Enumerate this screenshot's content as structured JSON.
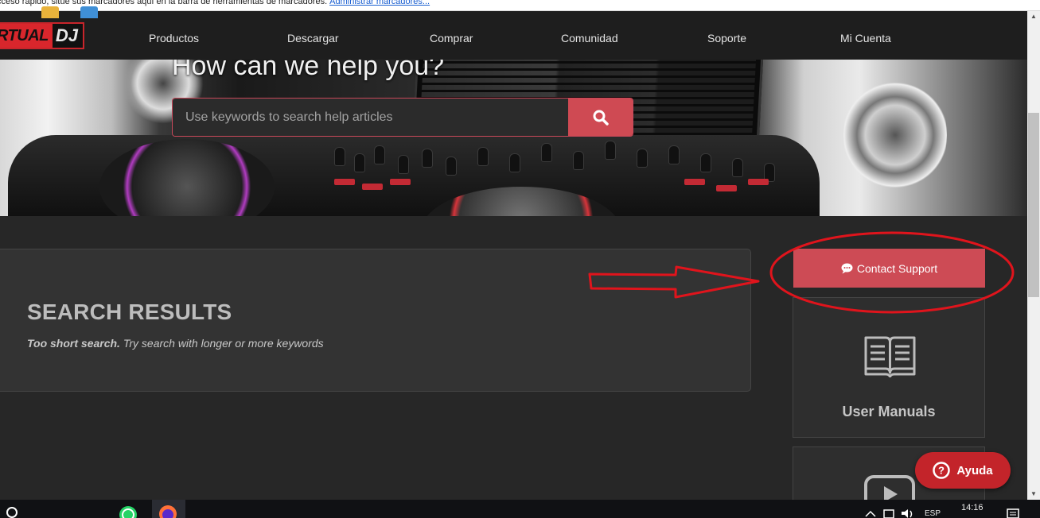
{
  "bookmark_bar": {
    "text": "cceso rápido, sitúe sus marcadores aquí en la barra de herramientas de marcadores.",
    "link": "Administrar marcadores..."
  },
  "logo": {
    "part_a": "RTUAL",
    "part_b": "DJ"
  },
  "nav": [
    "Productos",
    "Descargar",
    "Comprar",
    "Comunidad",
    "Soporte",
    "Mi Cuenta"
  ],
  "hero": {
    "title": "How can we help you?",
    "search_placeholder": "Use keywords to search help articles",
    "search_icon": "search-icon"
  },
  "results": {
    "title": "SEARCH RESULTS",
    "msg_bold": "Too short search.",
    "msg_rest": " Try search with longer or more keywords"
  },
  "sidebar": {
    "contact_label": "Contact Support",
    "contact_icon": "chat-bubble-icon",
    "manuals_label": "User Manuals",
    "manuals_icon": "open-book-icon",
    "video_icon": "play-icon"
  },
  "help_widget": {
    "label": "Ayuda",
    "icon": "question-circle-icon"
  },
  "colors": {
    "accent": "#cd4b55",
    "annotation": "#e0141c",
    "help_red": "#c3242a"
  },
  "taskbar": {
    "lang": "ESP",
    "time": "14:16"
  }
}
